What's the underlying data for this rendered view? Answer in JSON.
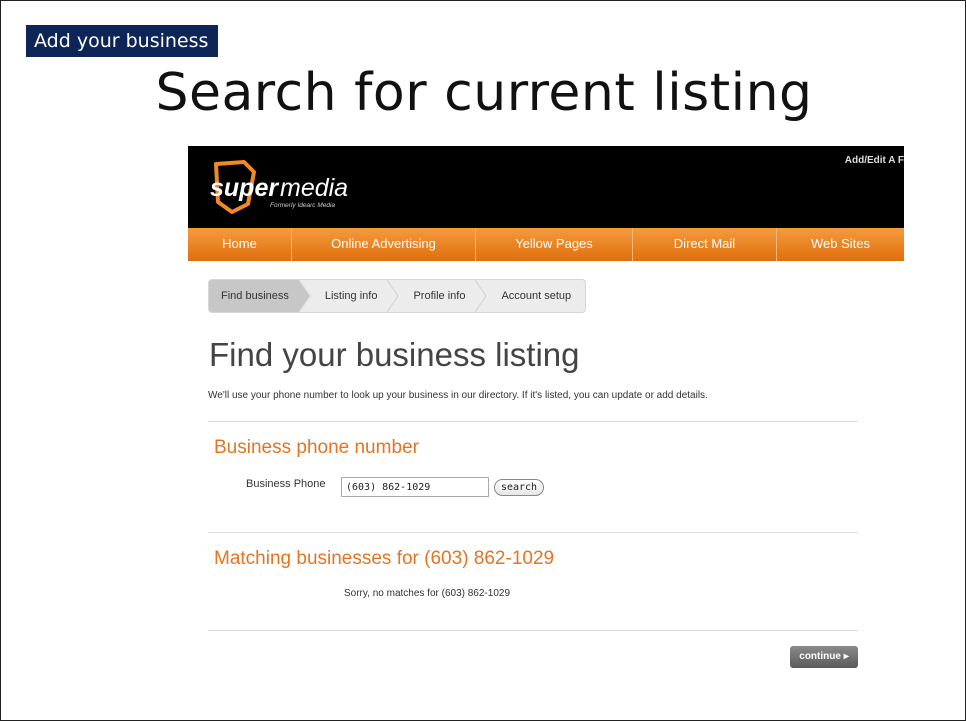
{
  "slide": {
    "tag": "Add your business",
    "title": "Search for current listing"
  },
  "site": {
    "logo": {
      "wordmark_bold": "super",
      "wordmark_light": "media",
      "tagline": "Formerly Idearc Media"
    },
    "top_link": "Add/Edit A F",
    "nav": [
      {
        "label": "Home"
      },
      {
        "label": "Online Advertising"
      },
      {
        "label": "Yellow Pages"
      },
      {
        "label": "Direct Mail"
      },
      {
        "label": "Web Sites"
      }
    ],
    "steps": [
      {
        "label": "Find business",
        "active": true
      },
      {
        "label": "Listing info",
        "active": false
      },
      {
        "label": "Profile info",
        "active": false
      },
      {
        "label": "Account setup",
        "active": false
      }
    ],
    "heading": "Find your business listing",
    "intro": "We'll use your phone number to look up your business in our directory. If it's listed, you can update or add details.",
    "phone_section": {
      "title": "Business phone number",
      "field_label": "Business Phone",
      "field_value": "(603) 862-1029",
      "search_label": "search"
    },
    "results_section": {
      "title": "Matching businesses for (603) 862-1029",
      "message": "Sorry, no matches for (603) 862-1029"
    },
    "continue_label": "continue ▸",
    "colors": {
      "brand_orange": "#e57422",
      "nav_orange": "#f0892c",
      "slide_tag_navy": "#0d2557"
    }
  }
}
